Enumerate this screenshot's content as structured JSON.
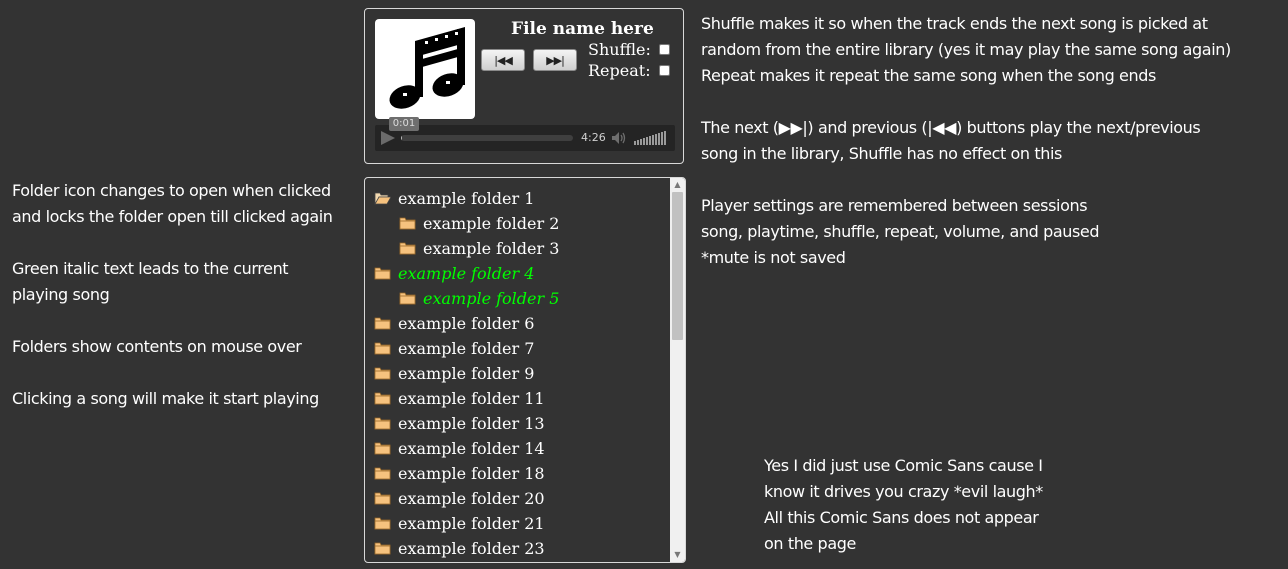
{
  "left_notes": [
    {
      "lines": [
        "Folder icon changes to open when clicked",
        "and locks the folder open till clicked again"
      ]
    },
    {
      "lines": [
        "Green italic text leads to the current",
        "playing song"
      ]
    },
    {
      "lines": [
        "Folders show contents on mouse over"
      ]
    },
    {
      "lines": [
        "Clicking a song will make it start playing"
      ]
    }
  ],
  "right_notes": [
    {
      "lines": [
        "Shuffle makes it so when the track ends the next song is picked at",
        "random from the entire library (yes it may play the same song again)",
        "Repeat makes it repeat the same song when the song ends"
      ]
    },
    {
      "lines": [
        "The next (▶▶|) and previous (|◀◀) buttons play the next/previous",
        "song in the library,  Shuffle has no effect on this"
      ]
    },
    {
      "lines": [
        "Player settings are remembered between sessions",
        "song, playtime, shuffle, repeat, volume, and paused",
        "*mute is not saved"
      ]
    }
  ],
  "bottom_note": {
    "lines": [
      "Yes I did just use Comic Sans cause I",
      "know it drives you crazy *evil laugh*",
      "All this Comic Sans does not appear",
      "on the page"
    ]
  },
  "player": {
    "file_name": "File name here",
    "prev_label": "|◀◀",
    "next_label": "▶▶|",
    "shuffle_label": "Shuffle:",
    "repeat_label": "Repeat:",
    "shuffle_checked": false,
    "repeat_checked": false,
    "current_time": "0:01",
    "duration": "4:26",
    "progress_fraction": 0.005,
    "volume_fraction": 1.0,
    "album_art_icon": "music-note-icon"
  },
  "tree": {
    "items": [
      {
        "label": "example folder 1",
        "level": 0,
        "open": true,
        "current": false
      },
      {
        "label": "example folder 2",
        "level": 1,
        "open": false,
        "current": false
      },
      {
        "label": "example folder 3",
        "level": 1,
        "open": false,
        "current": false
      },
      {
        "label": "example folder 4",
        "level": 0,
        "open": false,
        "current": true
      },
      {
        "label": "example folder 5",
        "level": 1,
        "open": false,
        "current": true
      },
      {
        "label": "example folder 6",
        "level": 0,
        "open": false,
        "current": false
      },
      {
        "label": "example folder 7",
        "level": 0,
        "open": false,
        "current": false
      },
      {
        "label": "example folder 9",
        "level": 0,
        "open": false,
        "current": false
      },
      {
        "label": "example folder 11",
        "level": 0,
        "open": false,
        "current": false
      },
      {
        "label": "example folder 13",
        "level": 0,
        "open": false,
        "current": false
      },
      {
        "label": "example folder 14",
        "level": 0,
        "open": false,
        "current": false
      },
      {
        "label": "example folder 18",
        "level": 0,
        "open": false,
        "current": false
      },
      {
        "label": "example folder 20",
        "level": 0,
        "open": false,
        "current": false
      },
      {
        "label": "example folder 21",
        "level": 0,
        "open": false,
        "current": false
      },
      {
        "label": "example folder 23",
        "level": 0,
        "open": false,
        "current": false
      }
    ]
  },
  "colors": {
    "background": "#333333",
    "current_song": "#00ff00",
    "folder": "#f6c27e"
  }
}
